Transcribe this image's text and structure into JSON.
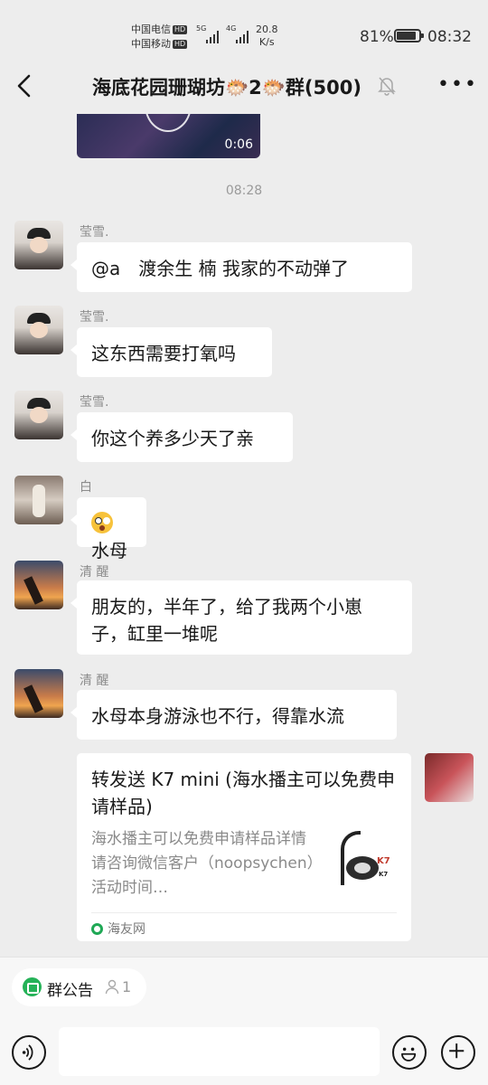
{
  "status_bar": {
    "carrier1": "中国电信",
    "carrier2": "中国移动",
    "hd": "HD",
    "net1": "5G",
    "net2": "4G",
    "speed_value": "20.8",
    "speed_unit": "K/s",
    "battery": "81%",
    "battery_level": 0.81,
    "time": "08:32"
  },
  "nav": {
    "title": "海底花园珊瑚坊🐡2🐡群(500)",
    "more": "•••"
  },
  "video": {
    "duration": "0:06"
  },
  "timestamp": "08:28",
  "messages": [
    {
      "sender": "莹雪.",
      "text": "@a　渡余生  楠  我家的不动弹了"
    },
    {
      "sender": "莹雪.",
      "text": "这东西需要打氧吗"
    },
    {
      "sender": "莹雪.",
      "text": "你这个养多少天了亲"
    },
    {
      "sender": "白",
      "text": "水母"
    },
    {
      "sender": "清 醒",
      "text": "朋友的，半年了，给了我两个小崽子，缸里一堆呢"
    },
    {
      "sender": "清 醒",
      "text": "水母本身游泳也不行，得靠水流"
    }
  ],
  "card": {
    "title": "转发送 K7 mini (海水播主可以免费申请样品)",
    "desc": "海水播主可以免费申请样品详情请咨询微信客户（noopsychen）活动时间…",
    "thumb_logo": "K7",
    "thumb_model": "K7",
    "source": "海友网"
  },
  "bottom": {
    "notice_label": "群公告",
    "notice_count": "1"
  }
}
